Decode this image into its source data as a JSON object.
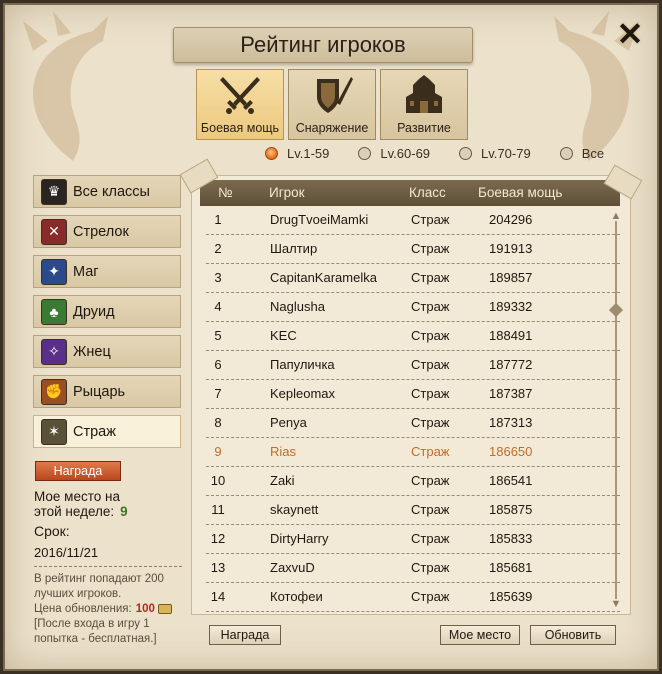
{
  "window": {
    "title": "Рейтинг игроков"
  },
  "category_tabs": [
    {
      "label": "Боевая мощь",
      "icon": "crossed-swords-icon",
      "active": true
    },
    {
      "label": "Снаряжение",
      "icon": "shield-sword-icon",
      "active": false
    },
    {
      "label": "Развитие",
      "icon": "fortress-icon",
      "active": false
    }
  ],
  "level_filters": [
    {
      "label": "Lv.1-59",
      "selected": true
    },
    {
      "label": "Lv.60-69",
      "selected": false
    },
    {
      "label": "Lv.70-79",
      "selected": false
    },
    {
      "label": "Все",
      "selected": false
    }
  ],
  "class_list": [
    {
      "label": "Все классы",
      "icon": "crown-icon",
      "color": "#2a2520",
      "active": false
    },
    {
      "label": "Стрелок",
      "icon": "crossed-arrows-icon",
      "color": "#8a2b2b",
      "active": false
    },
    {
      "label": "Маг",
      "icon": "flame-orb-icon",
      "color": "#2b4a8a",
      "active": false
    },
    {
      "label": "Друид",
      "icon": "tree-icon",
      "color": "#3a7a32",
      "active": false
    },
    {
      "label": "Жнец",
      "icon": "star-orb-icon",
      "color": "#5a2f8a",
      "active": false
    },
    {
      "label": "Рыцарь",
      "icon": "fist-icon",
      "color": "#9a4f22",
      "active": false
    },
    {
      "label": "Страж",
      "icon": "star-shield-icon",
      "color": "#5a5238",
      "active": true
    }
  ],
  "reward_button": "Награда",
  "my_place": {
    "label_line1": "Мое место на",
    "label_line2": "этой неделе:",
    "value": "9"
  },
  "deadline": {
    "label": "Срок:",
    "date": "2016/11/21"
  },
  "info": {
    "line1": "В рейтинг попадают 200 лучших игроков.",
    "cost_label": "Цена обновления:",
    "cost_value": "100",
    "note": "[После входа в игру 1 попытка - бесплатная.]"
  },
  "table": {
    "headers": {
      "rank": "№",
      "player": "Игрок",
      "class": "Класс",
      "power": "Боевая мощь"
    },
    "rows": [
      {
        "rank": "1",
        "player": "DrugTvoeiMamki",
        "class": "Страж",
        "power": "204296"
      },
      {
        "rank": "2",
        "player": "Шалтир",
        "class": "Страж",
        "power": "191913"
      },
      {
        "rank": "3",
        "player": "CapitanKaramelka",
        "class": "Страж",
        "power": "189857"
      },
      {
        "rank": "4",
        "player": "Naglusha",
        "class": "Страж",
        "power": "189332"
      },
      {
        "rank": "5",
        "player": "KEC",
        "class": "Страж",
        "power": "188491"
      },
      {
        "rank": "6",
        "player": "Папуличка",
        "class": "Страж",
        "power": "187772"
      },
      {
        "rank": "7",
        "player": "Kepleomax",
        "class": "Страж",
        "power": "187387"
      },
      {
        "rank": "8",
        "player": "Penya",
        "class": "Страж",
        "power": "187313"
      },
      {
        "rank": "9",
        "player": "Rias",
        "class": "Страж",
        "power": "186650",
        "highlight": true
      },
      {
        "rank": "10",
        "player": "Zaki",
        "class": "Страж",
        "power": "186541"
      },
      {
        "rank": "11",
        "player": "skaynett",
        "class": "Страж",
        "power": "185875"
      },
      {
        "rank": "12",
        "player": "DirtyHarry",
        "class": "Страж",
        "power": "185833"
      },
      {
        "rank": "13",
        "player": "ZaxvuD",
        "class": "Страж",
        "power": "185681"
      },
      {
        "rank": "14",
        "player": "Котофеи",
        "class": "Страж",
        "power": "185639"
      }
    ]
  },
  "footer_buttons": {
    "reward": "Награда",
    "my_place": "Мое место",
    "refresh": "Обновить"
  },
  "colors": {
    "highlight_row": "#c46a28",
    "cost": "#b2281c",
    "my_place_value": "#3a7a1e"
  }
}
